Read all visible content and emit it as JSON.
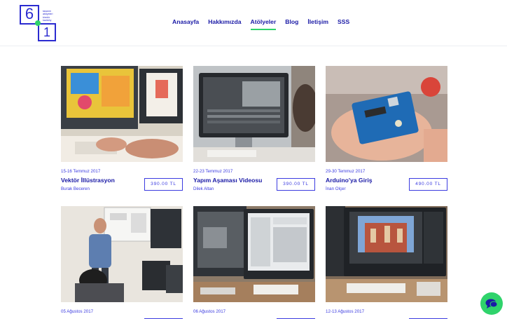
{
  "logo": {
    "digit_top": "6",
    "digit_bottom": "1",
    "tagline_lines": [
      "tasarım",
      "atölyeleri",
      "birebir",
      "kadıköy"
    ]
  },
  "nav": {
    "items": [
      {
        "label": "Anasayfa",
        "active": false
      },
      {
        "label": "Hakkımızda",
        "active": false
      },
      {
        "label": "Atölyeler",
        "active": true
      },
      {
        "label": "Blog",
        "active": false
      },
      {
        "label": "İletişim",
        "active": false
      },
      {
        "label": "SSS",
        "active": false
      }
    ]
  },
  "workshops": [
    {
      "date": "15-16 Temmuz 2017",
      "title": "Vektör İllüstrasyon",
      "instructor": "Burak Beceren",
      "price": "390.00 TL",
      "photo": "illustration-monitors-photo"
    },
    {
      "date": "22-23 Temmuz 2017",
      "title": "Yapım Aşaması Videosu",
      "instructor": "Dilek Altan",
      "price": "390.00 TL",
      "photo": "video-editing-monitor-photo"
    },
    {
      "date": "29-30 Temmuz 2017",
      "title": "Arduino'ya Giriş",
      "instructor": "İnan Olçer",
      "price": "490.00 TL",
      "photo": "arduino-board-hand-photo"
    },
    {
      "date": "05 Ağustos 2017",
      "photo": "presenter-classroom-photo"
    },
    {
      "date": "06 Ağustos 2017",
      "photo": "editing-software-monitors-photo"
    },
    {
      "date": "12-13 Ağustos 2017",
      "photo": "photo-retouch-monitor-photo"
    }
  ],
  "icons": {
    "chat": "chat-bubble-icon"
  },
  "colors": {
    "brand_blue": "#1a1aa6",
    "accent_green": "#2fd36b"
  }
}
